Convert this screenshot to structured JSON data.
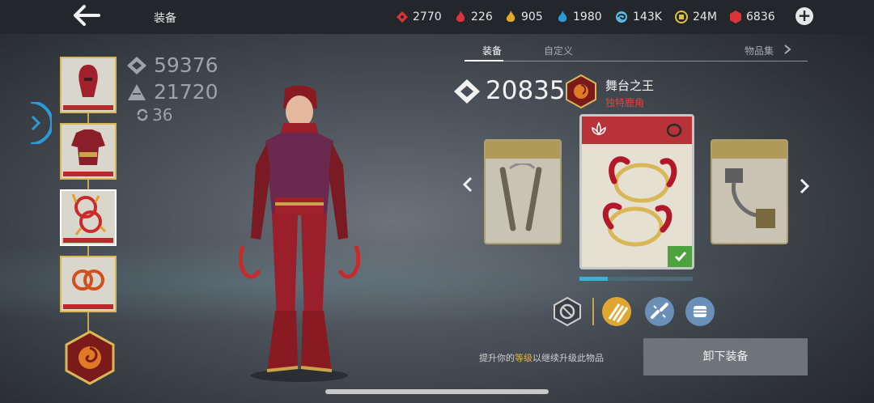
{
  "header": {
    "title": "装备",
    "resources": [
      {
        "name": "red-gem",
        "value": "2770",
        "color": "#d9343a"
      },
      {
        "name": "red-flame",
        "value": "226",
        "color": "#d9343a"
      },
      {
        "name": "gold-flame",
        "value": "905",
        "color": "#e3a92a"
      },
      {
        "name": "blue-flame",
        "value": "1980",
        "color": "#2b9bd8"
      },
      {
        "name": "blue-swirl",
        "value": "143K",
        "color": "#5bb6e0"
      },
      {
        "name": "gold-coin",
        "value": "24M",
        "color": "#e3c23a"
      },
      {
        "name": "ruby",
        "value": "6836",
        "color": "#d9343a"
      }
    ]
  },
  "character_stats": {
    "power": "59376",
    "armor": "21720",
    "level": "36"
  },
  "tabs": [
    "装备",
    "自定义",
    "物品集"
  ],
  "item": {
    "power": "20835",
    "name": "舞台之王",
    "rarity": "独特鹿角",
    "progress": 0.25
  },
  "hint": {
    "before": "提升你的",
    "highlight": "等级",
    "after": "以继续升级此物品"
  },
  "unequip_label": "卸下装备",
  "colors": {
    "accent_gold": "#c9a44b",
    "rarity_red": "#b72b2b",
    "progress_blue": "#38b3d6"
  }
}
